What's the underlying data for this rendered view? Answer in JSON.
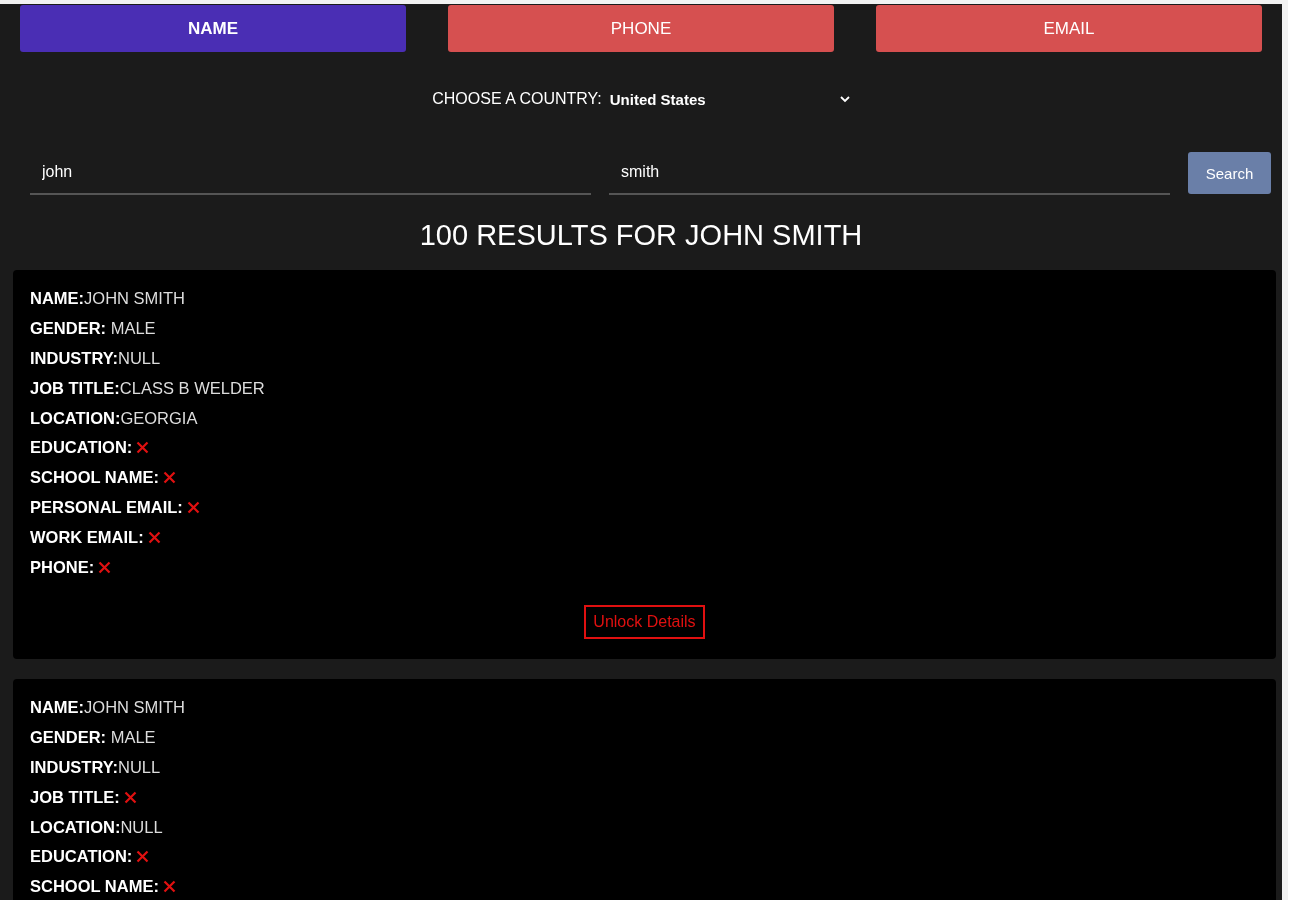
{
  "tabs": [
    {
      "label": "NAME",
      "selected": true
    },
    {
      "label": "PHONE",
      "selected": false
    },
    {
      "label": "EMAIL",
      "selected": false
    }
  ],
  "country": {
    "label": "CHOOSE A COUNTRY:",
    "value": "United States"
  },
  "search": {
    "first_name": "john",
    "last_name": "smith",
    "button": "Search"
  },
  "results_heading": "100 RESULTS FOR JOHN SMITH",
  "results": [
    {
      "fields": [
        {
          "text": "**NAME:**JOHN SMITH",
          "locked": false
        },
        {
          "text": "**GENDER:** MALE",
          "locked": false
        },
        {
          "text": "**INDUSTRY:**NULL",
          "locked": false
        },
        {
          "text": "**JOB TITLE:**CLASS B WELDER",
          "locked": false
        },
        {
          "text": "**LOCATION:**GEORGIA",
          "locked": false
        },
        {
          "text": "**EDUCATION:**",
          "locked": true
        },
        {
          "text": "**SCHOOL NAME:**",
          "locked": true
        },
        {
          "text": "**PERSONAL EMAIL:**",
          "locked": true
        },
        {
          "text": "**WORK EMAIL:**",
          "locked": true
        },
        {
          "text": "**PHONE:**",
          "locked": true
        }
      ],
      "button": "Unlock Details"
    },
    {
      "fields": [
        {
          "text": "**NAME:**JOHN SMITH",
          "locked": false
        },
        {
          "text": "**GENDER:** MALE",
          "locked": false
        },
        {
          "text": "**INDUSTRY:**NULL",
          "locked": false
        },
        {
          "text": "**JOB TITLE:**",
          "locked": true
        },
        {
          "text": "**LOCATION:**NULL",
          "locked": false
        },
        {
          "text": "**EDUCATION:**",
          "locked": true
        },
        {
          "text": "**SCHOOL NAME:**",
          "locked": true
        }
      ]
    }
  ]
}
